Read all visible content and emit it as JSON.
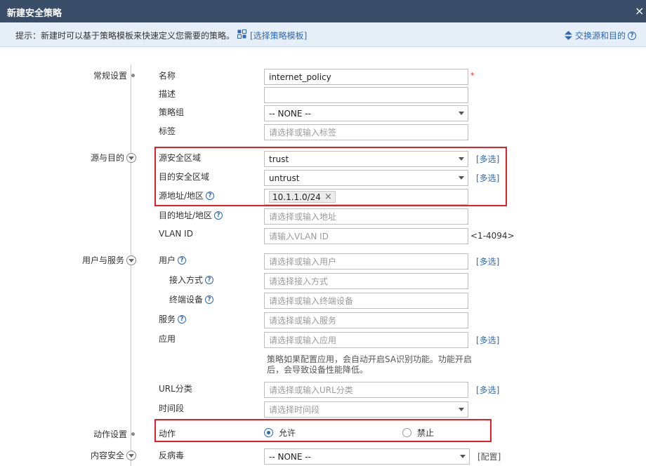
{
  "window": {
    "title": "新建安全策略",
    "close": "×"
  },
  "hint": {
    "text": "提示：新建时可以基于策略模板来快速定义您需要的策略。",
    "template_link": "[选择策略模板]",
    "swap_link": "交换源和目的"
  },
  "sections": {
    "general": "常规设置",
    "src_dst": "源与目的",
    "user_service": "用户与服务",
    "action": "动作设置",
    "content": "内容安全"
  },
  "fields": {
    "name": {
      "label": "名称",
      "value": "internet_policy",
      "required": "*"
    },
    "desc": {
      "label": "描述",
      "value": ""
    },
    "group": {
      "label": "策略组",
      "value": "-- NONE --"
    },
    "tag": {
      "label": "标签",
      "placeholder": "请选择或输入标签"
    },
    "src_zone": {
      "label": "源安全区域",
      "value": "trust",
      "more": "[多选]"
    },
    "dst_zone": {
      "label": "目的安全区域",
      "value": "untrust",
      "more": "[多选]"
    },
    "src_addr": {
      "label": "源地址/地区",
      "tag": "10.1.1.0/24",
      "remove": "×"
    },
    "dst_addr": {
      "label": "目的地址/地区",
      "placeholder": "请选择或输入地址"
    },
    "vlan": {
      "label": "VLAN ID",
      "placeholder": "请输入VLAN ID",
      "range": "<1-4094>"
    },
    "user": {
      "label": "用户",
      "placeholder": "请选择或输入用户",
      "more": "[多选]"
    },
    "access": {
      "label": "接入方式",
      "placeholder": "请选择接入方式"
    },
    "terminal": {
      "label": "终端设备",
      "placeholder": "请选择或输入终端设备"
    },
    "service": {
      "label": "服务",
      "placeholder": "请选择或输入服务"
    },
    "app": {
      "label": "应用",
      "placeholder": "请选择或输入应用",
      "more": "[多选]",
      "note": "策略如果配置应用，会自动开启SA识别功能。功能开启后，会导致设备性能降低。"
    },
    "url": {
      "label": "URL分类",
      "placeholder": "请选择或输入URL分类",
      "more": "[多选]"
    },
    "time": {
      "label": "时间段",
      "placeholder": "请选择时间段"
    },
    "action": {
      "label": "动作",
      "allow": "允许",
      "deny": "禁止",
      "selected": "允许"
    },
    "antivirus": {
      "label": "反病毒",
      "value": "-- NONE --",
      "config": "[配置]"
    }
  },
  "colors": {
    "accent": "#2a6ab8",
    "titlebar": "#3a4d68",
    "highlight": "#e0202a"
  }
}
